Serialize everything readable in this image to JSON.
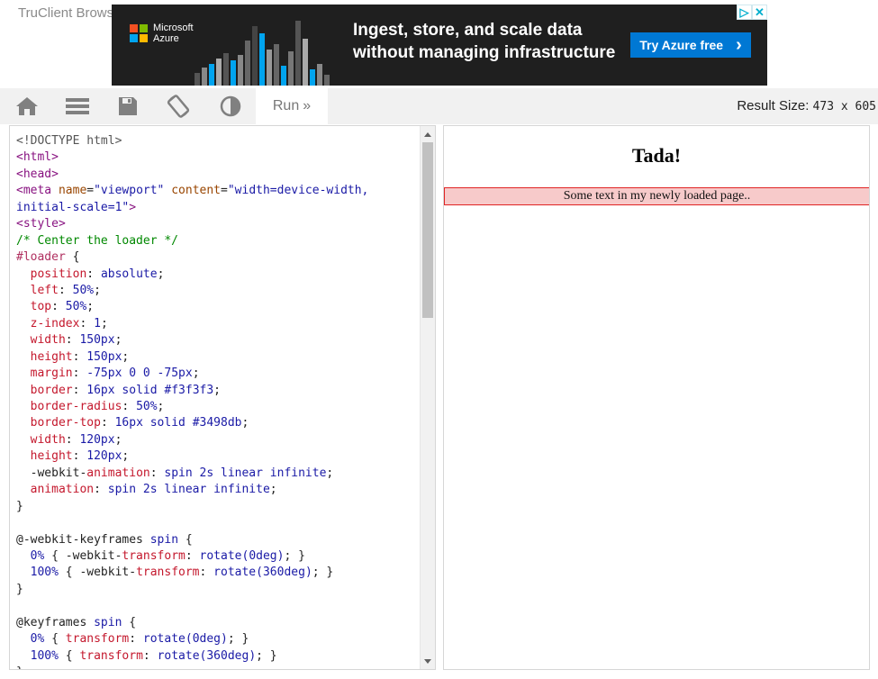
{
  "window": {
    "title": "TruClient Browser"
  },
  "ad": {
    "brand": "Microsoft Azure",
    "brand_line1": "Microsoft",
    "brand_line2": "Azure",
    "headline_line1": "Ingest, store, and scale data",
    "headline_line2": "without managing infrastructure",
    "cta_label": "Try Azure free",
    "cta_arrow": "›",
    "choices_icon": "▷",
    "close_icon": "✕",
    "colors": {
      "background": "#1f1f1f",
      "cta": "#0078d4",
      "ms_red": "#f25022",
      "ms_green": "#7fba00",
      "ms_blue": "#00a4ef",
      "ms_yellow": "#ffb900"
    }
  },
  "toolbar": {
    "icons": [
      "home-icon",
      "menu-icon",
      "save-icon",
      "rotate-icon",
      "contrast-icon"
    ],
    "run_label": "Run",
    "run_chevron": "»",
    "result_size_label": "Result Size:",
    "result_size_value": "473 x 605"
  },
  "editor": {
    "lines": [
      [
        {
          "c": "t-dt",
          "t": "<!DOCTYPE html>"
        }
      ],
      [
        {
          "c": "t-tag",
          "t": "<html>"
        }
      ],
      [
        {
          "c": "t-tag",
          "t": "<head>"
        }
      ],
      [
        {
          "c": "t-tag",
          "t": "<meta "
        },
        {
          "c": "t-attr",
          "t": "name"
        },
        {
          "c": "t-pun",
          "t": "="
        },
        {
          "c": "t-str",
          "t": "\"viewport\""
        },
        {
          "c": "t-pun",
          "t": " "
        },
        {
          "c": "t-attr",
          "t": "content"
        },
        {
          "c": "t-pun",
          "t": "="
        },
        {
          "c": "t-str",
          "t": "\"width=device-width,"
        }
      ],
      [
        {
          "c": "t-str",
          "t": "initial-scale=1\""
        },
        {
          "c": "t-tag",
          "t": ">"
        }
      ],
      [
        {
          "c": "t-tag",
          "t": "<style>"
        }
      ],
      [
        {
          "c": "t-com",
          "t": "/* Center the loader */"
        }
      ],
      [
        {
          "c": "t-sel",
          "t": "#loader"
        },
        {
          "c": "t-pun",
          "t": " {"
        }
      ],
      [
        {
          "c": "t-pun",
          "t": "  "
        },
        {
          "c": "t-prop",
          "t": "position"
        },
        {
          "c": "t-pun",
          "t": ": "
        },
        {
          "c": "t-val",
          "t": "absolute"
        },
        {
          "c": "t-pun",
          "t": ";"
        }
      ],
      [
        {
          "c": "t-pun",
          "t": "  "
        },
        {
          "c": "t-prop",
          "t": "left"
        },
        {
          "c": "t-pun",
          "t": ": "
        },
        {
          "c": "t-num",
          "t": "50%"
        },
        {
          "c": "t-pun",
          "t": ";"
        }
      ],
      [
        {
          "c": "t-pun",
          "t": "  "
        },
        {
          "c": "t-prop",
          "t": "top"
        },
        {
          "c": "t-pun",
          "t": ": "
        },
        {
          "c": "t-num",
          "t": "50%"
        },
        {
          "c": "t-pun",
          "t": ";"
        }
      ],
      [
        {
          "c": "t-pun",
          "t": "  "
        },
        {
          "c": "t-prop",
          "t": "z-index"
        },
        {
          "c": "t-pun",
          "t": ": "
        },
        {
          "c": "t-num",
          "t": "1"
        },
        {
          "c": "t-pun",
          "t": ";"
        }
      ],
      [
        {
          "c": "t-pun",
          "t": "  "
        },
        {
          "c": "t-prop",
          "t": "width"
        },
        {
          "c": "t-pun",
          "t": ": "
        },
        {
          "c": "t-num",
          "t": "150px"
        },
        {
          "c": "t-pun",
          "t": ";"
        }
      ],
      [
        {
          "c": "t-pun",
          "t": "  "
        },
        {
          "c": "t-prop",
          "t": "height"
        },
        {
          "c": "t-pun",
          "t": ": "
        },
        {
          "c": "t-num",
          "t": "150px"
        },
        {
          "c": "t-pun",
          "t": ";"
        }
      ],
      [
        {
          "c": "t-pun",
          "t": "  "
        },
        {
          "c": "t-prop",
          "t": "margin"
        },
        {
          "c": "t-pun",
          "t": ": "
        },
        {
          "c": "t-num",
          "t": "-75px 0 0 -75px"
        },
        {
          "c": "t-pun",
          "t": ";"
        }
      ],
      [
        {
          "c": "t-pun",
          "t": "  "
        },
        {
          "c": "t-prop",
          "t": "border"
        },
        {
          "c": "t-pun",
          "t": ": "
        },
        {
          "c": "t-num",
          "t": "16px"
        },
        {
          "c": "t-pun",
          "t": " "
        },
        {
          "c": "t-val",
          "t": "solid #f3f3f3"
        },
        {
          "c": "t-pun",
          "t": ";"
        }
      ],
      [
        {
          "c": "t-pun",
          "t": "  "
        },
        {
          "c": "t-prop",
          "t": "border-radius"
        },
        {
          "c": "t-pun",
          "t": ": "
        },
        {
          "c": "t-num",
          "t": "50%"
        },
        {
          "c": "t-pun",
          "t": ";"
        }
      ],
      [
        {
          "c": "t-pun",
          "t": "  "
        },
        {
          "c": "t-prop",
          "t": "border-top"
        },
        {
          "c": "t-pun",
          "t": ": "
        },
        {
          "c": "t-num",
          "t": "16px"
        },
        {
          "c": "t-pun",
          "t": " "
        },
        {
          "c": "t-val",
          "t": "solid #3498db"
        },
        {
          "c": "t-pun",
          "t": ";"
        }
      ],
      [
        {
          "c": "t-pun",
          "t": "  "
        },
        {
          "c": "t-prop",
          "t": "width"
        },
        {
          "c": "t-pun",
          "t": ": "
        },
        {
          "c": "t-num",
          "t": "120px"
        },
        {
          "c": "t-pun",
          "t": ";"
        }
      ],
      [
        {
          "c": "t-pun",
          "t": "  "
        },
        {
          "c": "t-prop",
          "t": "height"
        },
        {
          "c": "t-pun",
          "t": ": "
        },
        {
          "c": "t-num",
          "t": "120px"
        },
        {
          "c": "t-pun",
          "t": ";"
        }
      ],
      [
        {
          "c": "t-pun",
          "t": "  -webkit-"
        },
        {
          "c": "t-prop",
          "t": "animation"
        },
        {
          "c": "t-pun",
          "t": ": "
        },
        {
          "c": "t-val",
          "t": "spin 2s linear infinite"
        },
        {
          "c": "t-pun",
          "t": ";"
        }
      ],
      [
        {
          "c": "t-pun",
          "t": "  "
        },
        {
          "c": "t-prop",
          "t": "animation"
        },
        {
          "c": "t-pun",
          "t": ": "
        },
        {
          "c": "t-val",
          "t": "spin 2s linear infinite"
        },
        {
          "c": "t-pun",
          "t": ";"
        }
      ],
      [
        {
          "c": "t-pun",
          "t": "}"
        }
      ],
      [
        {
          "c": "t-pun",
          "t": ""
        }
      ],
      [
        {
          "c": "t-pun",
          "t": "@-webkit-keyframes "
        },
        {
          "c": "t-val",
          "t": "spin"
        },
        {
          "c": "t-pun",
          "t": " {"
        }
      ],
      [
        {
          "c": "t-pun",
          "t": "  "
        },
        {
          "c": "t-num",
          "t": "0%"
        },
        {
          "c": "t-pun",
          "t": " { -webkit-"
        },
        {
          "c": "t-prop",
          "t": "transform"
        },
        {
          "c": "t-pun",
          "t": ": "
        },
        {
          "c": "t-val",
          "t": "rotate("
        },
        {
          "c": "t-num",
          "t": "0deg"
        },
        {
          "c": "t-val",
          "t": ")"
        },
        {
          "c": "t-pun",
          "t": "; }"
        }
      ],
      [
        {
          "c": "t-pun",
          "t": "  "
        },
        {
          "c": "t-num",
          "t": "100%"
        },
        {
          "c": "t-pun",
          "t": " { -webkit-"
        },
        {
          "c": "t-prop",
          "t": "transform"
        },
        {
          "c": "t-pun",
          "t": ": "
        },
        {
          "c": "t-val",
          "t": "rotate("
        },
        {
          "c": "t-num",
          "t": "360deg"
        },
        {
          "c": "t-val",
          "t": ")"
        },
        {
          "c": "t-pun",
          "t": "; }"
        }
      ],
      [
        {
          "c": "t-pun",
          "t": "}"
        }
      ],
      [
        {
          "c": "t-pun",
          "t": ""
        }
      ],
      [
        {
          "c": "t-pun",
          "t": "@keyframes "
        },
        {
          "c": "t-val",
          "t": "spin"
        },
        {
          "c": "t-pun",
          "t": " {"
        }
      ],
      [
        {
          "c": "t-pun",
          "t": "  "
        },
        {
          "c": "t-num",
          "t": "0%"
        },
        {
          "c": "t-pun",
          "t": " { "
        },
        {
          "c": "t-prop",
          "t": "transform"
        },
        {
          "c": "t-pun",
          "t": ": "
        },
        {
          "c": "t-val",
          "t": "rotate("
        },
        {
          "c": "t-num",
          "t": "0deg"
        },
        {
          "c": "t-val",
          "t": ")"
        },
        {
          "c": "t-pun",
          "t": "; }"
        }
      ],
      [
        {
          "c": "t-pun",
          "t": "  "
        },
        {
          "c": "t-num",
          "t": "100%"
        },
        {
          "c": "t-pun",
          "t": " { "
        },
        {
          "c": "t-prop",
          "t": "transform"
        },
        {
          "c": "t-pun",
          "t": ": "
        },
        {
          "c": "t-val",
          "t": "rotate("
        },
        {
          "c": "t-num",
          "t": "360deg"
        },
        {
          "c": "t-val",
          "t": ")"
        },
        {
          "c": "t-pun",
          "t": "; }"
        }
      ],
      [
        {
          "c": "t-pun",
          "t": "}"
        }
      ]
    ],
    "scrollbar_up_icon": "▲",
    "scrollbar_down_icon": "▼"
  },
  "result": {
    "heading": "Tada!",
    "text": "Some text in my newly loaded page.."
  }
}
